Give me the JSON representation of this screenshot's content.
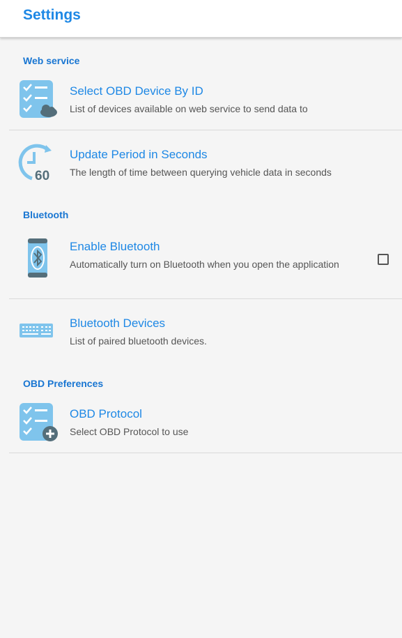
{
  "appbar": {
    "title": "Settings"
  },
  "sections": {
    "web_service": "Web service",
    "bluetooth": "Bluetooth",
    "obd_preferences": "OBD Preferences"
  },
  "items": {
    "select_device": {
      "title": "Select OBD Device By ID",
      "subtitle": "List of devices available on web service to send data to",
      "icon": "checklist-cloud-icon"
    },
    "update_period": {
      "title": "Update Period in Seconds",
      "subtitle": "The length of time between querying vehicle data in seconds",
      "icon": "timer-icon",
      "icon_text": "60"
    },
    "enable_bluetooth": {
      "title": "Enable Bluetooth",
      "subtitle": "Automatically turn on Bluetooth when you open the application",
      "icon": "phone-bluetooth-icon",
      "checked": false
    },
    "bluetooth_devices": {
      "title": "Bluetooth Devices",
      "subtitle": "List of paired bluetooth devices.",
      "icon": "keyboard-icon"
    },
    "obd_protocol": {
      "title": "OBD Protocol",
      "subtitle": "Select OBD Protocol to use",
      "icon": "checklist-add-icon"
    }
  },
  "colors": {
    "accent": "#1e88e5",
    "icon_light": "#7fc4ec",
    "icon_dark": "#546e7a",
    "background": "#f5f5f5"
  }
}
